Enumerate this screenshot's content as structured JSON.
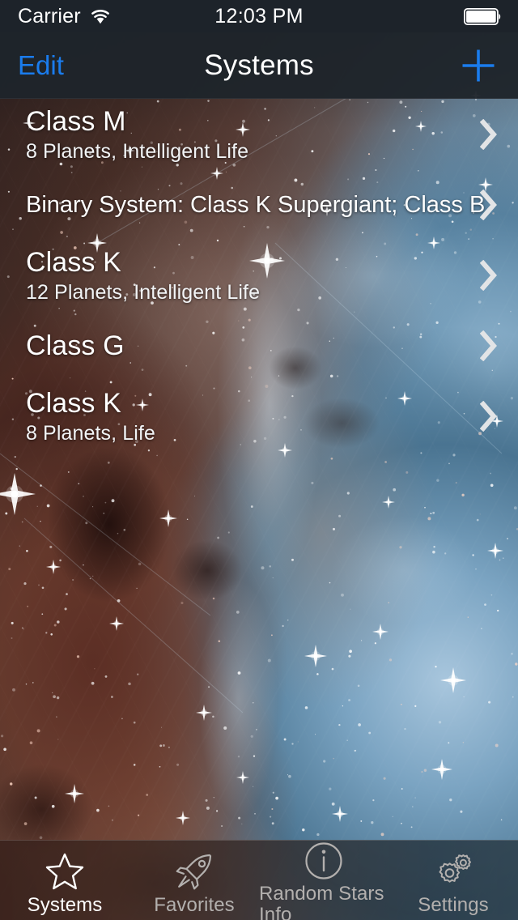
{
  "status_bar": {
    "carrier": "Carrier",
    "wifi_icon": "wifi-icon",
    "time": "12:03 PM",
    "battery_icon": "battery-full-icon"
  },
  "nav_bar": {
    "left_button": "Edit",
    "title": "Systems",
    "right_button_icon": "plus-icon",
    "accent_color": "#1a7ced"
  },
  "list": {
    "rows": [
      {
        "title": "Class M",
        "subtitle": "8 Planets, Intelligent Life",
        "accessory_icon": "chevron-right-icon"
      },
      {
        "title": "Binary System: Class K Supergiant; Class B",
        "subtitle": "",
        "accessory_icon": "chevron-right-icon"
      },
      {
        "title": "Class K",
        "subtitle": "12 Planets, Intelligent Life",
        "accessory_icon": "chevron-right-icon"
      },
      {
        "title": "Class G",
        "subtitle": "",
        "accessory_icon": "chevron-right-icon"
      },
      {
        "title": "Class K",
        "subtitle": "8 Planets, Life",
        "accessory_icon": "chevron-right-icon"
      }
    ]
  },
  "tab_bar": {
    "tabs": [
      {
        "label": "Systems",
        "icon": "star-icon",
        "active": true
      },
      {
        "label": "Favorites",
        "icon": "rocket-icon",
        "active": false
      },
      {
        "label": "Random Stars Info",
        "icon": "info-circle-icon",
        "active": false
      },
      {
        "label": "Settings",
        "icon": "gears-icon",
        "active": false
      }
    ],
    "active_color": "#ffffff",
    "inactive_color": "#b3b0ae"
  }
}
